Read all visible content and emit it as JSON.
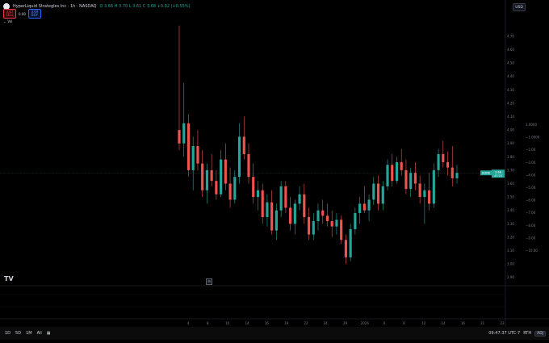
{
  "header": {
    "title": "HyperLiquid Strategies Inc · 1h · NASDAQ",
    "ohlc": "O 3.66  H 3.70  L 3.61  C 3.68  +0.02 (+0.55%)",
    "currency": "USD",
    "sell_price": "3.67",
    "sell_label": "SELL",
    "spread": "0.00",
    "buy_price": "3.69",
    "buy_label": "BUY",
    "vol_toggle": "Vol"
  },
  "price_axis": {
    "labels": [
      "4.70",
      "4.60",
      "4.50",
      "4.40",
      "4.30",
      "4.20",
      "4.10",
      "4.00",
      "3.90",
      "3.80",
      "3.70",
      "3.60",
      "3.50",
      "3.40",
      "3.30",
      "3.20",
      "3.10",
      "3.00",
      "2.90"
    ],
    "pct_labels": [
      "1.0000",
      "−1.0000",
      "−2.00",
      "−3.00",
      "−4.00",
      "−5.00",
      "−6.00",
      "−7.00",
      "−8.00",
      "−9.00",
      "−10.00"
    ],
    "price_tag_ticker": "HURE",
    "price_tag_value": "3.68",
    "price_tag_time": "47:23"
  },
  "time_axis": {
    "labels": [
      "4",
      "8",
      "10",
      "14",
      "16",
      "19",
      "22",
      "24",
      "29",
      "2026",
      "6",
      "8",
      "12",
      "14",
      "16",
      "21",
      "23"
    ]
  },
  "bottom": {
    "timeframes": [
      "1D",
      "5D",
      "1M",
      "All"
    ],
    "calendar_icon": "calendar-icon",
    "clock": "09:47:37 UTC-7",
    "session": "RTH",
    "adj": "ADJ"
  },
  "chart_data": {
    "type": "candlestick",
    "ylim": [
      2.85,
      4.85
    ],
    "up_color": "#26a69a",
    "down_color": "#ef5350",
    "last_price": 3.68,
    "series": [
      {
        "o": 4.0,
        "h": 4.78,
        "l": 3.85,
        "c": 3.9
      },
      {
        "o": 3.9,
        "h": 4.35,
        "l": 3.8,
        "c": 4.05
      },
      {
        "o": 4.05,
        "h": 4.12,
        "l": 3.65,
        "c": 3.7
      },
      {
        "o": 3.7,
        "h": 3.95,
        "l": 3.55,
        "c": 3.88
      },
      {
        "o": 3.88,
        "h": 4.0,
        "l": 3.7,
        "c": 3.75
      },
      {
        "o": 3.75,
        "h": 3.85,
        "l": 3.5,
        "c": 3.55
      },
      {
        "o": 3.55,
        "h": 3.75,
        "l": 3.45,
        "c": 3.7
      },
      {
        "o": 3.7,
        "h": 3.82,
        "l": 3.58,
        "c": 3.62
      },
      {
        "o": 3.62,
        "h": 3.7,
        "l": 3.48,
        "c": 3.52
      },
      {
        "o": 3.52,
        "h": 3.85,
        "l": 3.5,
        "c": 3.78
      },
      {
        "o": 3.78,
        "h": 3.9,
        "l": 3.55,
        "c": 3.6
      },
      {
        "o": 3.6,
        "h": 3.72,
        "l": 3.42,
        "c": 3.48
      },
      {
        "o": 3.48,
        "h": 3.7,
        "l": 3.45,
        "c": 3.65
      },
      {
        "o": 3.65,
        "h": 4.05,
        "l": 3.6,
        "c": 3.95
      },
      {
        "o": 3.95,
        "h": 4.1,
        "l": 3.78,
        "c": 3.82
      },
      {
        "o": 3.82,
        "h": 3.9,
        "l": 3.6,
        "c": 3.65
      },
      {
        "o": 3.65,
        "h": 3.75,
        "l": 3.45,
        "c": 3.5
      },
      {
        "o": 3.5,
        "h": 3.62,
        "l": 3.4,
        "c": 3.55
      },
      {
        "o": 3.55,
        "h": 3.6,
        "l": 3.3,
        "c": 3.35
      },
      {
        "o": 3.35,
        "h": 3.52,
        "l": 3.28,
        "c": 3.46
      },
      {
        "o": 3.46,
        "h": 3.55,
        "l": 3.22,
        "c": 3.25
      },
      {
        "o": 3.25,
        "h": 3.45,
        "l": 3.18,
        "c": 3.4
      },
      {
        "o": 3.4,
        "h": 3.62,
        "l": 3.35,
        "c": 3.58
      },
      {
        "o": 3.58,
        "h": 3.62,
        "l": 3.38,
        "c": 3.42
      },
      {
        "o": 3.42,
        "h": 3.5,
        "l": 3.25,
        "c": 3.3
      },
      {
        "o": 3.3,
        "h": 3.48,
        "l": 3.22,
        "c": 3.45
      },
      {
        "o": 3.45,
        "h": 3.58,
        "l": 3.4,
        "c": 3.52
      },
      {
        "o": 3.52,
        "h": 3.6,
        "l": 3.3,
        "c": 3.35
      },
      {
        "o": 3.35,
        "h": 3.42,
        "l": 3.18,
        "c": 3.22
      },
      {
        "o": 3.22,
        "h": 3.38,
        "l": 3.18,
        "c": 3.32
      },
      {
        "o": 3.32,
        "h": 3.45,
        "l": 3.25,
        "c": 3.4
      },
      {
        "o": 3.4,
        "h": 3.48,
        "l": 3.3,
        "c": 3.36
      },
      {
        "o": 3.36,
        "h": 3.45,
        "l": 3.28,
        "c": 3.32
      },
      {
        "o": 3.32,
        "h": 3.4,
        "l": 3.2,
        "c": 3.28
      },
      {
        "o": 3.28,
        "h": 3.38,
        "l": 3.22,
        "c": 3.33
      },
      {
        "o": 3.33,
        "h": 3.36,
        "l": 3.15,
        "c": 3.18
      },
      {
        "o": 3.18,
        "h": 3.22,
        "l": 3.0,
        "c": 3.05
      },
      {
        "o": 3.05,
        "h": 3.3,
        "l": 3.02,
        "c": 3.26
      },
      {
        "o": 3.26,
        "h": 3.42,
        "l": 3.22,
        "c": 3.38
      },
      {
        "o": 3.38,
        "h": 3.5,
        "l": 3.3,
        "c": 3.45
      },
      {
        "o": 3.45,
        "h": 3.58,
        "l": 3.38,
        "c": 3.4
      },
      {
        "o": 3.4,
        "h": 3.52,
        "l": 3.32,
        "c": 3.48
      },
      {
        "o": 3.48,
        "h": 3.65,
        "l": 3.44,
        "c": 3.6
      },
      {
        "o": 3.6,
        "h": 3.66,
        "l": 3.4,
        "c": 3.45
      },
      {
        "o": 3.45,
        "h": 3.62,
        "l": 3.4,
        "c": 3.58
      },
      {
        "o": 3.58,
        "h": 3.78,
        "l": 3.55,
        "c": 3.74
      },
      {
        "o": 3.74,
        "h": 3.82,
        "l": 3.58,
        "c": 3.62
      },
      {
        "o": 3.62,
        "h": 3.8,
        "l": 3.6,
        "c": 3.76
      },
      {
        "o": 3.76,
        "h": 3.86,
        "l": 3.66,
        "c": 3.7
      },
      {
        "o": 3.7,
        "h": 3.78,
        "l": 3.52,
        "c": 3.56
      },
      {
        "o": 3.56,
        "h": 3.72,
        "l": 3.5,
        "c": 3.68
      },
      {
        "o": 3.68,
        "h": 3.76,
        "l": 3.55,
        "c": 3.6
      },
      {
        "o": 3.6,
        "h": 3.66,
        "l": 3.45,
        "c": 3.5
      },
      {
        "o": 3.5,
        "h": 3.6,
        "l": 3.3,
        "c": 3.55
      },
      {
        "o": 3.55,
        "h": 3.68,
        "l": 3.4,
        "c": 3.45
      },
      {
        "o": 3.45,
        "h": 3.75,
        "l": 3.42,
        "c": 3.7
      },
      {
        "o": 3.7,
        "h": 3.86,
        "l": 3.65,
        "c": 3.82
      },
      {
        "o": 3.82,
        "h": 3.92,
        "l": 3.72,
        "c": 3.76
      },
      {
        "o": 3.76,
        "h": 3.84,
        "l": 3.66,
        "c": 3.72
      },
      {
        "o": 3.72,
        "h": 3.88,
        "l": 3.58,
        "c": 3.64
      },
      {
        "o": 3.64,
        "h": 3.74,
        "l": 3.6,
        "c": 3.68
      }
    ]
  }
}
